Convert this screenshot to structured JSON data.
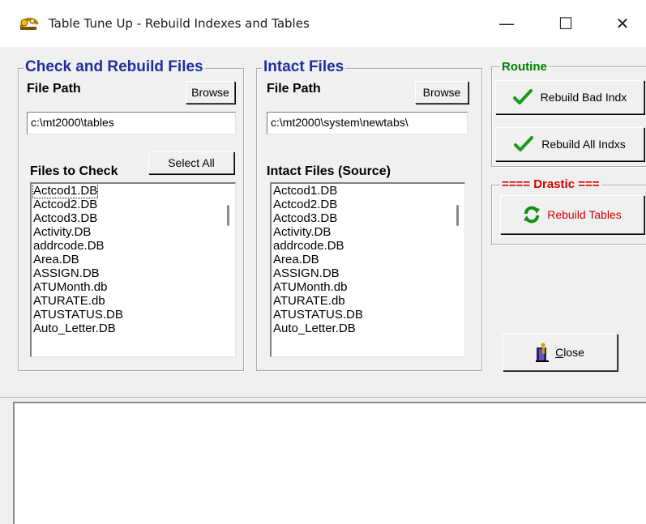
{
  "window": {
    "title": "Table Tune Up - Rebuild Indexes and Tables",
    "minimize": "—",
    "maximize": "☐",
    "close": "✕"
  },
  "check_group": {
    "title": "Check and Rebuild Files",
    "file_path_label": "File Path",
    "browse_label": "Browse",
    "path_value": "c:\\mt2000\\tables",
    "files_label": "Files to Check",
    "select_all_label": "Select All",
    "files": [
      "Actcod1.DB",
      "Actcod2.DB",
      "Actcod3.DB",
      "Activity.DB",
      "addrcode.DB",
      "Area.DB",
      "ASSIGN.DB",
      "ATUMonth.db",
      "ATURATE.db",
      "ATUSTATUS.DB",
      "Auto_Letter.DB"
    ]
  },
  "intact_group": {
    "title": "Intact Files",
    "file_path_label": "File Path",
    "browse_label": "Browse",
    "path_value": "c:\\mt2000\\system\\newtabs\\",
    "files_label": "Intact Files (Source)",
    "files": [
      "Actcod1.DB",
      "Actcod2.DB",
      "Actcod3.DB",
      "Activity.DB",
      "addrcode.DB",
      "Area.DB",
      "ASSIGN.DB",
      "ATUMonth.db",
      "ATURATE.db",
      "ATUSTATUS.DB",
      "Auto_Letter.DB"
    ]
  },
  "routine_group": {
    "title": "Routine",
    "rebuild_bad_label": "Rebuild Bad Indx",
    "rebuild_all_label": "Rebuild All Indxs"
  },
  "drastic_group": {
    "title": "==== Drastic ===",
    "rebuild_tables_label": "Rebuild Tables"
  },
  "close_button": {
    "label_mnemonic": "C",
    "label_rest": "lose"
  },
  "colors": {
    "group_title_blue": "#1f2fa0",
    "routine_green": "#008000",
    "drastic_red": "#d40000",
    "check_green": "#1a9a1a"
  }
}
